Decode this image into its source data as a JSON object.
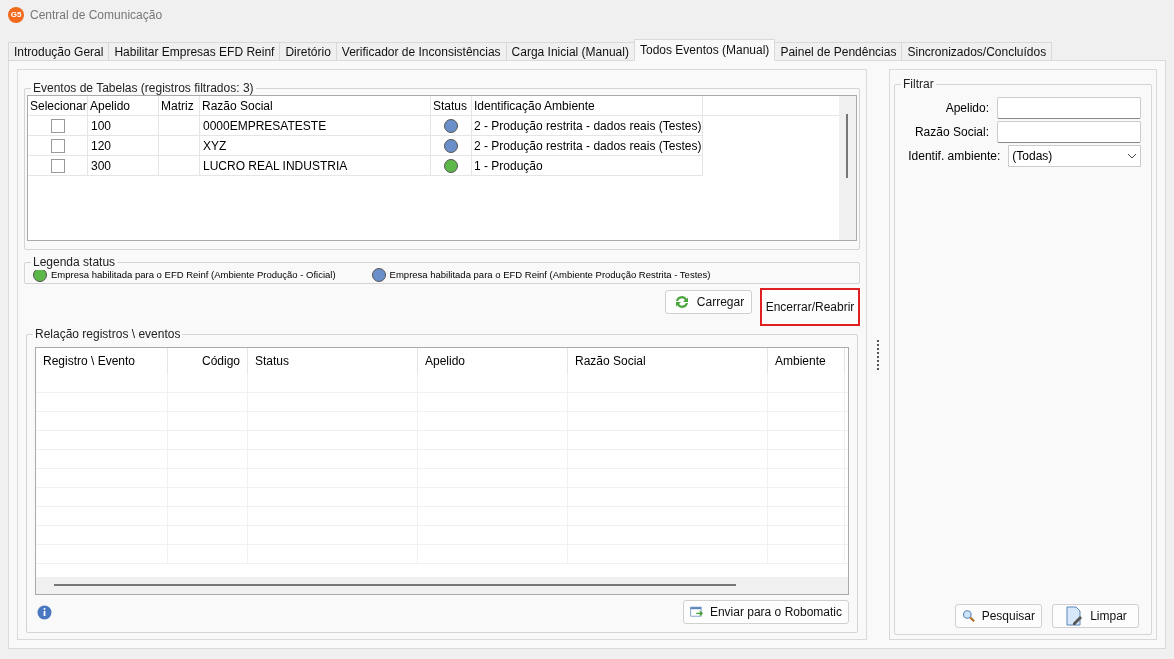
{
  "window": {
    "title": "Central de Comunicação",
    "logo_text": "G5"
  },
  "tabs": [
    {
      "label": "Introdução Geral",
      "selected": false
    },
    {
      "label": "Habilitar Empresas EFD Reinf",
      "selected": false
    },
    {
      "label": "Diretório",
      "selected": false
    },
    {
      "label": "Verificador de Inconsistências",
      "selected": false
    },
    {
      "label": "Carga Inicial (Manual)",
      "selected": false
    },
    {
      "label": "Todos Eventos (Manual)",
      "selected": true
    },
    {
      "label": "Painel de Pendências",
      "selected": false
    },
    {
      "label": "Sincronizados/Concluídos",
      "selected": false
    }
  ],
  "events_table": {
    "title": "Eventos de Tabelas (registros filtrados: 3)",
    "columns": [
      "Selecionar",
      "Apelido",
      "Matriz",
      "Razão Social",
      "Status",
      "Identificação Ambiente"
    ],
    "rows": [
      {
        "checked": false,
        "apelido": "100",
        "razao_social": "0000EMPRESATESTE",
        "color": "#6b8fc8",
        "ambiente": "2 - Produção restrita - dados reais (Testes)"
      },
      {
        "checked": false,
        "apelido": "120",
        "razao_social": "XYZ",
        "color": "#6b8fc8",
        "ambiente": "2 - Produção restrita - dados reais (Testes)"
      },
      {
        "checked": false,
        "apelido": "300",
        "razao_social": "LUCRO REAL INDUSTRIA",
        "color": "#5cb848",
        "ambiente": "1 - Produção"
      }
    ]
  },
  "legend": {
    "title": "Legenda status",
    "items": [
      {
        "color": "#5cb848",
        "label": "Empresa habilitada para o EFD Reinf (Ambiente Produção - Oficial)"
      },
      {
        "color": "#6b8fc8",
        "label": "Empresa habilitada para o EFD Reinf (Ambiente Produção Restrita - Testes)"
      }
    ]
  },
  "actions": [
    {
      "kind": "reload",
      "label": "Carregar",
      "highlighted": false
    },
    {
      "kind": "plain",
      "label": "Encerrar/Reabrir",
      "highlighted": true
    }
  ],
  "records_table": {
    "title": "Relação registros \\ eventos",
    "columns": [
      "Registro \\ Evento",
      "Código",
      "Status",
      "Apelido",
      "Razão Social",
      "Ambiente"
    ]
  },
  "send_button": {
    "label": "Enviar para o Robomatic"
  },
  "filter": {
    "title": "Filtrar",
    "fields": [
      {
        "kind": "text",
        "label": "Apelido:"
      },
      {
        "kind": "text",
        "label": "Razão Social:"
      },
      {
        "kind": "select",
        "label": "Identif. ambiente:",
        "value": "(Todas)"
      }
    ],
    "buttons": [
      {
        "kind": "search",
        "label": "Pesquisar"
      },
      {
        "kind": "clear",
        "label": "Limpar"
      }
    ]
  }
}
